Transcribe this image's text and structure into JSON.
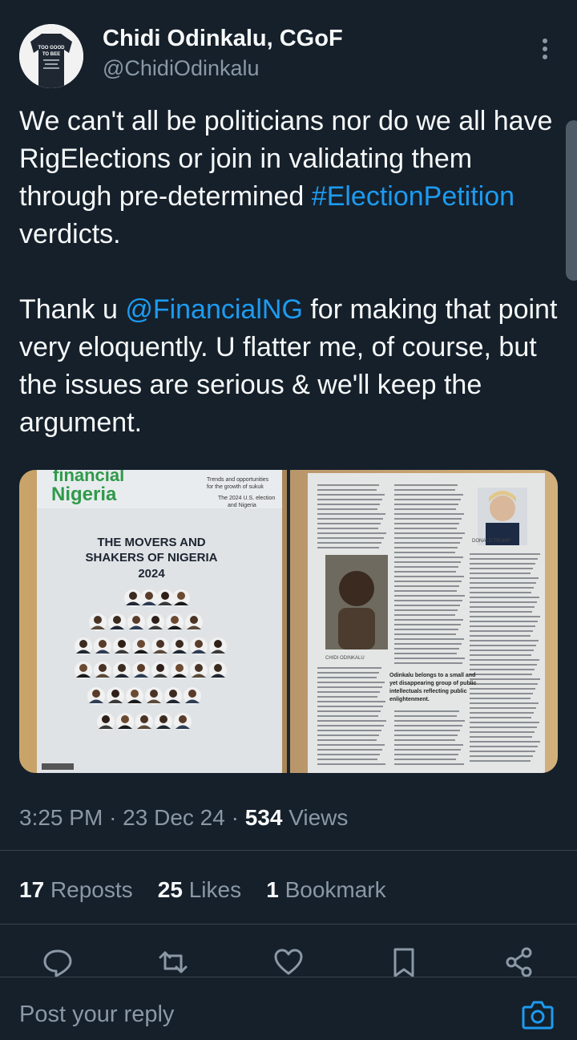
{
  "author": {
    "display_name": "Chidi Odinkalu, CGoF",
    "handle": "@ChidiOdinkalu",
    "avatar_text": [
      "TOO GOOD",
      "TO BEE"
    ]
  },
  "tweet": {
    "p1_a": "We can't all be politicians nor do we all have RigElections or join in validating them through pre-determined ",
    "p1_hashtag": "#ElectionPetition",
    "p1_b": " verdicts.",
    "p2_a": "Thank u ",
    "p2_mention": "@FinancialNG",
    "p2_b": " for making that point very eloquently. U flatter me, of course, but the issues are serious & we'll keep the argument."
  },
  "media": {
    "magazine_brand_top": "financial",
    "magazine_brand": "Nigeria",
    "topics": [
      "Trends and opportunities",
      "for the growth of sukuk",
      "The 2024 U.S. election",
      "and Nigeria"
    ],
    "cover_title": [
      "THE MOVERS AND",
      "SHAKERS OF NIGERIA",
      "2024"
    ],
    "photo_caption_left": "CHIDI ODINKALU",
    "photo_caption_right": "DONALD TRUMP",
    "pull_quote": [
      "Odinkalu belongs to a small and",
      "yet disappearing group of public",
      "intellectuals reflecting public",
      "enlightenment."
    ]
  },
  "meta": {
    "time": "3:25 PM",
    "sep": "·",
    "date": "23 Dec 24",
    "views_count": "534",
    "views_label": "Views"
  },
  "stats": {
    "reposts_count": "17",
    "reposts_label": "Reposts",
    "likes_count": "25",
    "likes_label": "Likes",
    "bookmarks_count": "1",
    "bookmarks_label": "Bookmark"
  },
  "reply": {
    "placeholder": "Post your reply"
  },
  "colors": {
    "background": "#15202b",
    "accent": "#1d9bf0",
    "secondary_text": "#8b98a5"
  },
  "icons": [
    "more-icon",
    "reply-icon",
    "repost-icon",
    "like-icon",
    "bookmark-icon",
    "share-icon",
    "camera-icon"
  ]
}
